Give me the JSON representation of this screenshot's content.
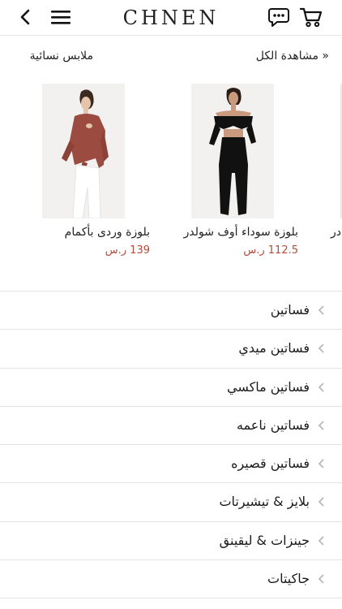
{
  "header": {
    "logo": "CHNEN",
    "icons": {
      "back": "chevron-left-icon",
      "menu": "hamburger-menu-icon",
      "chat": "chat-bubble-icon",
      "cart": "shopping-cart-icon"
    }
  },
  "section": {
    "title": "ملابس نسائية",
    "view_all": "« مشاهدة الكل"
  },
  "products": [
    {
      "name": "بلوزة وردى بأكمام",
      "price": "139 ر.س",
      "image": "woman-in-rust-wrap-blouse-photo"
    },
    {
      "name": "بلوزة سوداء أوف شولدر",
      "price": "112.5 ر.س",
      "image": "woman-in-black-off-shoulder-outfit-photo"
    },
    {
      "name": "در",
      "price": "",
      "image": "partial-product-photo"
    }
  ],
  "categories": [
    {
      "label": "فساتين"
    },
    {
      "label": "فساتين ميدي"
    },
    {
      "label": "فساتين ماكسي"
    },
    {
      "label": "فساتين ناعمه"
    },
    {
      "label": "فساتين قصيره"
    },
    {
      "label": "بلايز & تيشيرتات"
    },
    {
      "label": "جينزات & ليقينق"
    },
    {
      "label": "جاكيتات"
    }
  ],
  "colors": {
    "price": "#b84a3a",
    "divider": "#e3e3e3",
    "text": "#1a1a1a"
  }
}
